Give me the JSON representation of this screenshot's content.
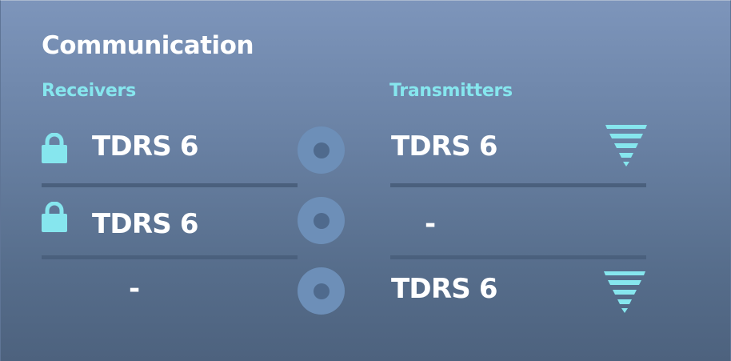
{
  "panel": {
    "title": "Communication"
  },
  "columns": {
    "receivers_label": "Receivers",
    "transmitters_label": "Transmitters"
  },
  "rows": [
    {
      "receiver": {
        "name": "TDRS 6",
        "locked": true
      },
      "transmitter": {
        "name": "TDRS 6",
        "signal": true
      }
    },
    {
      "receiver": {
        "name": "TDRS 6",
        "locked": true
      },
      "transmitter": {
        "name": "-",
        "signal": false
      }
    },
    {
      "receiver": {
        "name": "-",
        "locked": false
      },
      "transmitter": {
        "name": "TDRS 6",
        "signal": true
      }
    }
  ],
  "icons": {
    "lock": "lock-icon",
    "link": "link-ring-icon",
    "signal": "signal-strength-icon"
  },
  "colors": {
    "accent": "#86e6ee",
    "text": "#ffffff",
    "ring": "#6d8fb8",
    "divider": "#4a607d"
  }
}
